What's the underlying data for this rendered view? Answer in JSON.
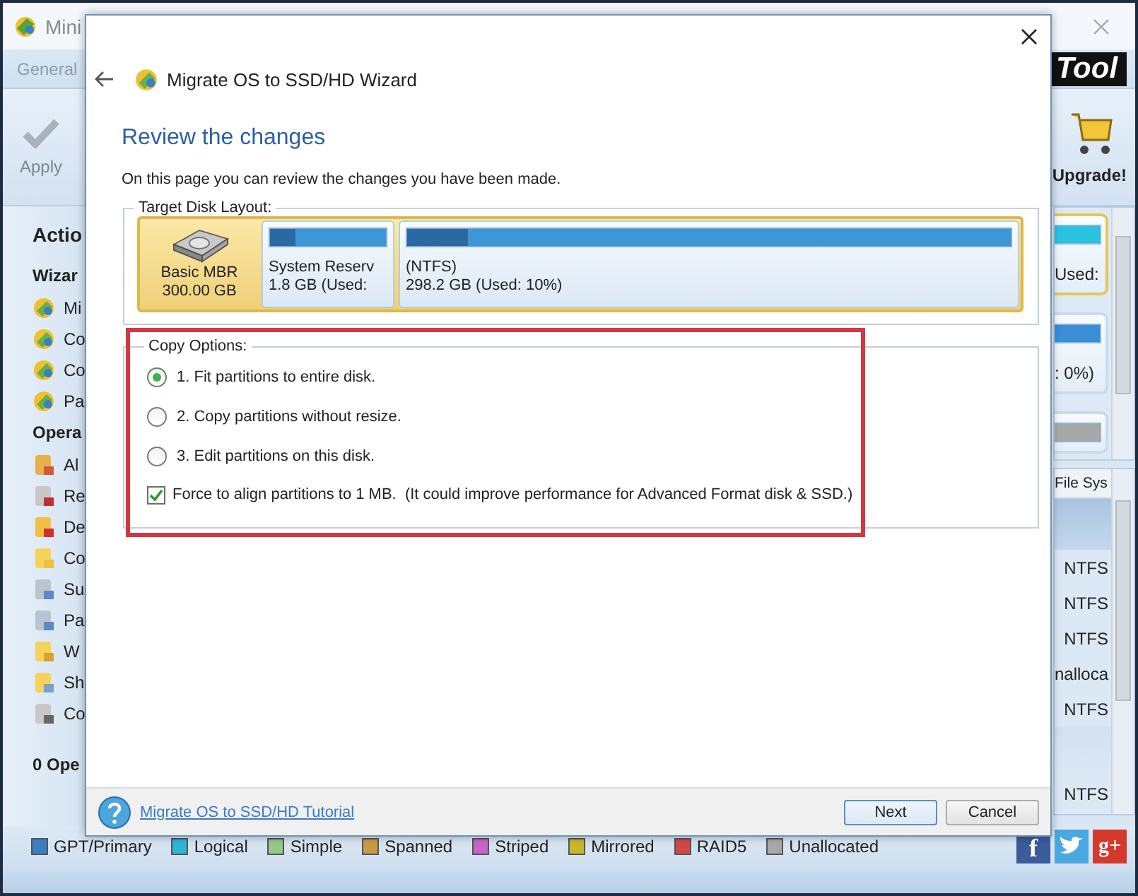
{
  "app": {
    "title": "Mini",
    "menu_tabs": [
      {
        "label": "General",
        "selected": false
      }
    ],
    "toolbar": [
      {
        "label": "Apply",
        "disabled": true
      }
    ],
    "logo": "Tool",
    "upgrade": "Upgrade!"
  },
  "sidebar": {
    "title": "Actio",
    "sections": [
      {
        "title": "Wizar",
        "kind": "wizard",
        "items": [
          "Mi",
          "Co",
          "Co",
          "Pa"
        ]
      },
      {
        "title": "Opera",
        "kind": "operation",
        "items": [
          "Al",
          "Re",
          "De",
          "Co",
          "Su",
          "Pa",
          "W",
          "Sh",
          "Co"
        ]
      }
    ],
    "pending": "0 Ope"
  },
  "disk_map": {
    "cards": [
      {
        "text": "Used:",
        "selected": true,
        "color": "#29c3e0"
      },
      {
        "text": ": 0%)",
        "selected": false,
        "color": "#3a8fd6"
      },
      {
        "selected": false,
        "color": "#a8a8a8"
      }
    ]
  },
  "partition_table": {
    "column": "File Sys",
    "rows": [
      {
        "kind": "disk",
        "selected": true
      },
      {
        "kind": "partition",
        "cell": "NTFS",
        "selected": false
      },
      {
        "kind": "partition",
        "cell": "NTFS",
        "selected": false
      },
      {
        "kind": "partition",
        "cell": "NTFS",
        "selected": false
      },
      {
        "kind": "partition",
        "cell": "nalloca",
        "selected": false
      },
      {
        "kind": "partition",
        "cell": "NTFS",
        "selected": false
      },
      {
        "kind": "disk",
        "selected": false
      },
      {
        "kind": "partition",
        "cell": "NTFS",
        "selected": false
      }
    ]
  },
  "legend": [
    {
      "label": "GPT/Primary",
      "color": "#3a7fc1"
    },
    {
      "label": "Logical",
      "color": "#2bb6d8"
    },
    {
      "label": "Simple",
      "color": "#93c98a"
    },
    {
      "label": "Spanned",
      "color": "#c99a45"
    },
    {
      "label": "Striped",
      "color": "#c766c9"
    },
    {
      "label": "Mirrored",
      "color": "#c9b72e"
    },
    {
      "label": "RAID5",
      "color": "#d24848"
    },
    {
      "label": "Unallocated",
      "color": "#a9a9a9"
    }
  ],
  "social": [
    {
      "kind": "facebook",
      "glyph": "f"
    },
    {
      "kind": "twitter"
    },
    {
      "kind": "google",
      "glyph": "g+"
    }
  ],
  "dialog": {
    "title": "Migrate OS to SSD/HD Wizard",
    "heading": "Review the changes",
    "description": "On this page you can review the changes you have been made.",
    "layout_group": {
      "label": "Target Disk Layout:",
      "disk": {
        "name": "Basic MBR",
        "size": "300.00 GB",
        "selected": true
      },
      "partitions": [
        {
          "label": "System Reserv",
          "detail": "1.8 GB (Used:",
          "level": 0.22
        },
        {
          "label": "(NTFS)",
          "detail": "298.2 GB (Used: 10%)",
          "level": 0.1
        }
      ]
    },
    "copy_group": {
      "label": "Copy Options:",
      "options": [
        {
          "label": "1. Fit partitions to entire disk.",
          "selected": true
        },
        {
          "label": "2. Copy partitions without resize.",
          "selected": false
        },
        {
          "label": "3. Edit partitions on this disk.",
          "selected": false
        }
      ],
      "align": {
        "label": "Force to align partitions to 1 MB.  (It could improve performance for Advanced Format disk & SSD.)",
        "checked": true
      }
    },
    "help_link": "Migrate OS to SSD/HD Tutorial",
    "buttons": [
      {
        "label": "Next",
        "kind": "default"
      },
      {
        "label": "Cancel",
        "kind": "normal"
      }
    ]
  }
}
